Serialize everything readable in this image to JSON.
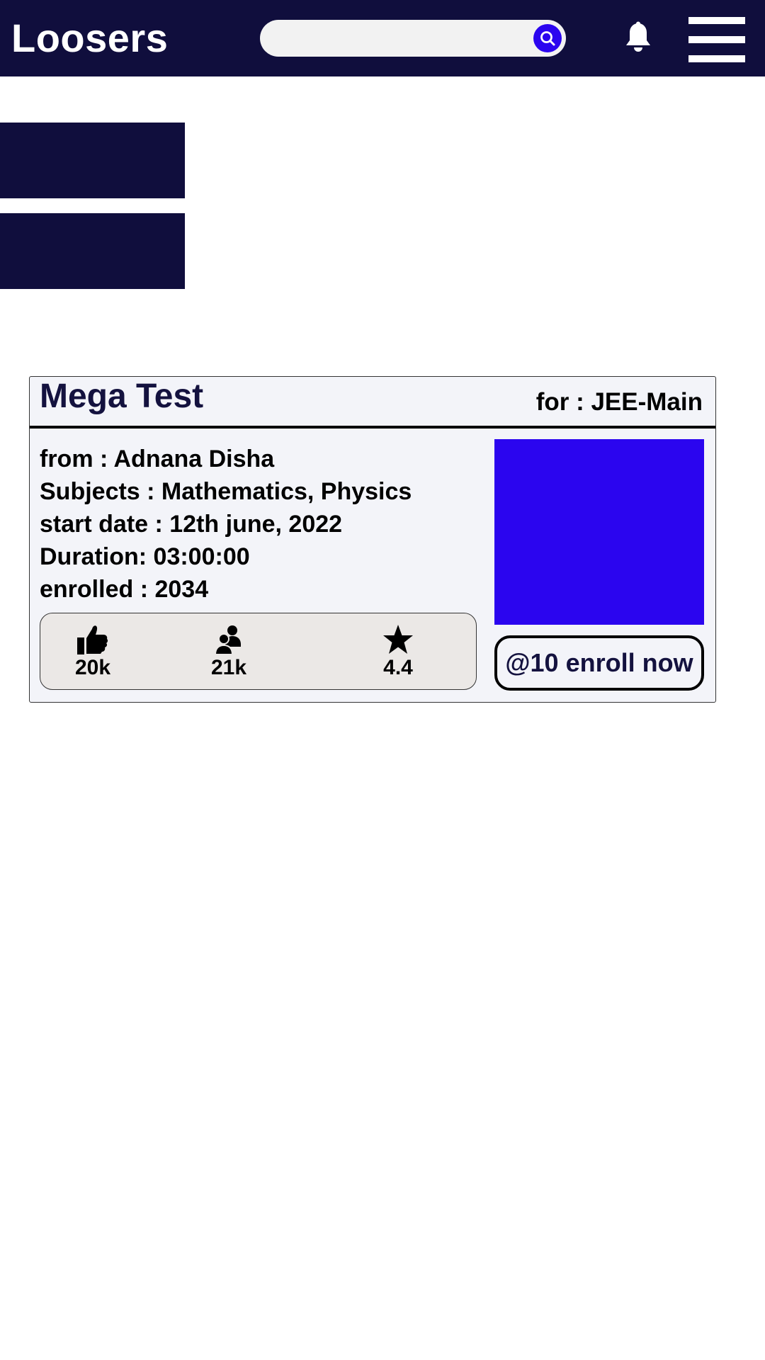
{
  "header": {
    "app_title": "Loosers",
    "search": {
      "value": "",
      "placeholder": ""
    },
    "search_icon": "search-icon",
    "notification_icon": "bell-icon",
    "menu_icon": "hamburger-menu-icon"
  },
  "colors": {
    "navy": "#100e3d",
    "accent_blue": "#2b05ef",
    "card_bg": "#f3f4f9",
    "stats_bg": "#ebe8e6"
  },
  "test_card": {
    "title": "Mega Test",
    "exam": "for : JEE-Main",
    "details": [
      "from : Adnana Disha",
      "Subjects : Mathematics, Physics",
      "start date : 12th june, 2022",
      "Duration: 03:00:00",
      "enrolled : 2034"
    ],
    "stats": {
      "likes": {
        "icon": "thumbs-up-icon",
        "value": "20k"
      },
      "followers": {
        "icon": "users-icon",
        "value": "21k"
      },
      "rating": {
        "icon": "star-icon",
        "value": "4.4"
      }
    },
    "enroll_label": "@10 enroll now"
  }
}
